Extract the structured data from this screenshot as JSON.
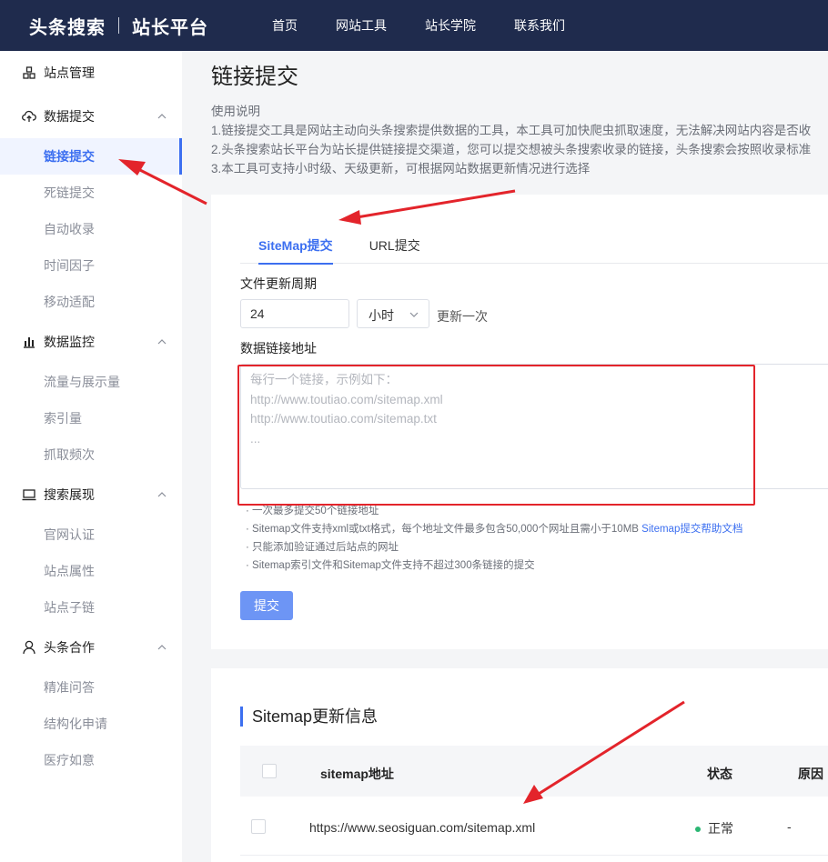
{
  "header": {
    "brand": "头条搜索",
    "product": "站长平台",
    "nav": [
      "首页",
      "网站工具",
      "站长学院",
      "联系我们"
    ]
  },
  "sidebar": {
    "groups": [
      {
        "label": "站点管理",
        "icon": "site-icon",
        "items": []
      },
      {
        "label": "数据提交",
        "icon": "cloud-upload-icon",
        "items": [
          "链接提交",
          "死链提交",
          "自动收录",
          "时间因子",
          "移动适配"
        ]
      },
      {
        "label": "数据监控",
        "icon": "bar-chart-icon",
        "items": [
          "流量与展示量",
          "索引量",
          "抓取频次"
        ]
      },
      {
        "label": "搜索展现",
        "icon": "monitor-icon",
        "items": [
          "官网认证",
          "站点属性",
          "站点子链"
        ]
      },
      {
        "label": "头条合作",
        "icon": "user-icon",
        "items": [
          "精准问答",
          "结构化申请",
          "医疗如意"
        ]
      }
    ],
    "active_item": "链接提交"
  },
  "main": {
    "title": "链接提交",
    "usage_title": "使用说明",
    "usage_lines": [
      "1.链接提交工具是网站主动向头条搜索提供数据的工具，本工具可加快爬虫抓取速度，无法解决网站内容是否收",
      "2.头条搜索站长平台为站长提供链接提交渠道，您可以提交想被头条搜索收录的链接，头条搜索会按照收录标准",
      "3.本工具可支持小时级、天级更新，可根据网站数据更新情况进行选择"
    ],
    "tabs": [
      "SiteMap提交",
      "URL提交"
    ],
    "period_label": "文件更新周期",
    "period_value": "24",
    "unit_value": "小时",
    "period_suffix": "更新一次",
    "address_label": "数据链接地址",
    "textarea_placeholder_lines": [
      "每行一个链接，示例如下：",
      "http://www.toutiao.com/sitemap.xml",
      "http://www.toutiao.com/sitemap.txt",
      "..."
    ],
    "notes": [
      "· 一次最多提交50个链接地址",
      "· Sitemap文件支持xml或txt格式，每个地址文件最多包含50,000个网址且需小于10MB",
      "· 只能添加验证通过后站点的网址",
      "· Sitemap索引文件和Sitemap文件支持不超过300条链接的提交"
    ],
    "help_link": "Sitemap提交帮助文档",
    "submit_label": "提交"
  },
  "sitemap_info": {
    "title": "Sitemap更新信息",
    "columns": [
      "sitemap地址",
      "状态",
      "原因"
    ],
    "rows": [
      {
        "url": "https://www.seosiguan.com/sitemap.xml",
        "status": "正常",
        "reason": "-"
      }
    ]
  },
  "colors": {
    "header_bg": "#1f2b4d",
    "accent": "#3c6ff0",
    "annotation_red": "#e3242b",
    "status_ok": "#2bb673"
  }
}
